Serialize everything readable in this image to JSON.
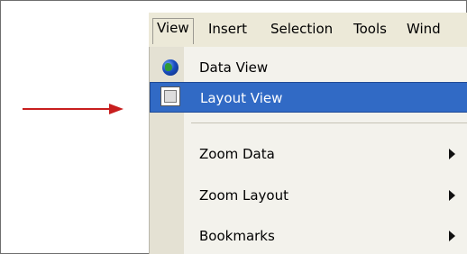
{
  "menubar": {
    "items": [
      {
        "label": "View"
      },
      {
        "label": "Insert"
      },
      {
        "label": "Selection"
      },
      {
        "label": "Tools"
      },
      {
        "label": "Wind"
      }
    ]
  },
  "dropdown": {
    "items": [
      {
        "label": "Data View",
        "icon": "globe-icon",
        "submenu": false
      },
      {
        "label": "Layout View",
        "icon": "layout-icon",
        "submenu": false,
        "highlighted": true
      },
      {
        "label": "Zoom Data",
        "submenu": true
      },
      {
        "label": "Zoom Layout",
        "submenu": true
      },
      {
        "label": "Bookmarks",
        "submenu": true
      }
    ]
  },
  "colors": {
    "highlight": "#316ac5",
    "arrow": "#c81e1e",
    "menu_bg": "#ece9d8"
  }
}
